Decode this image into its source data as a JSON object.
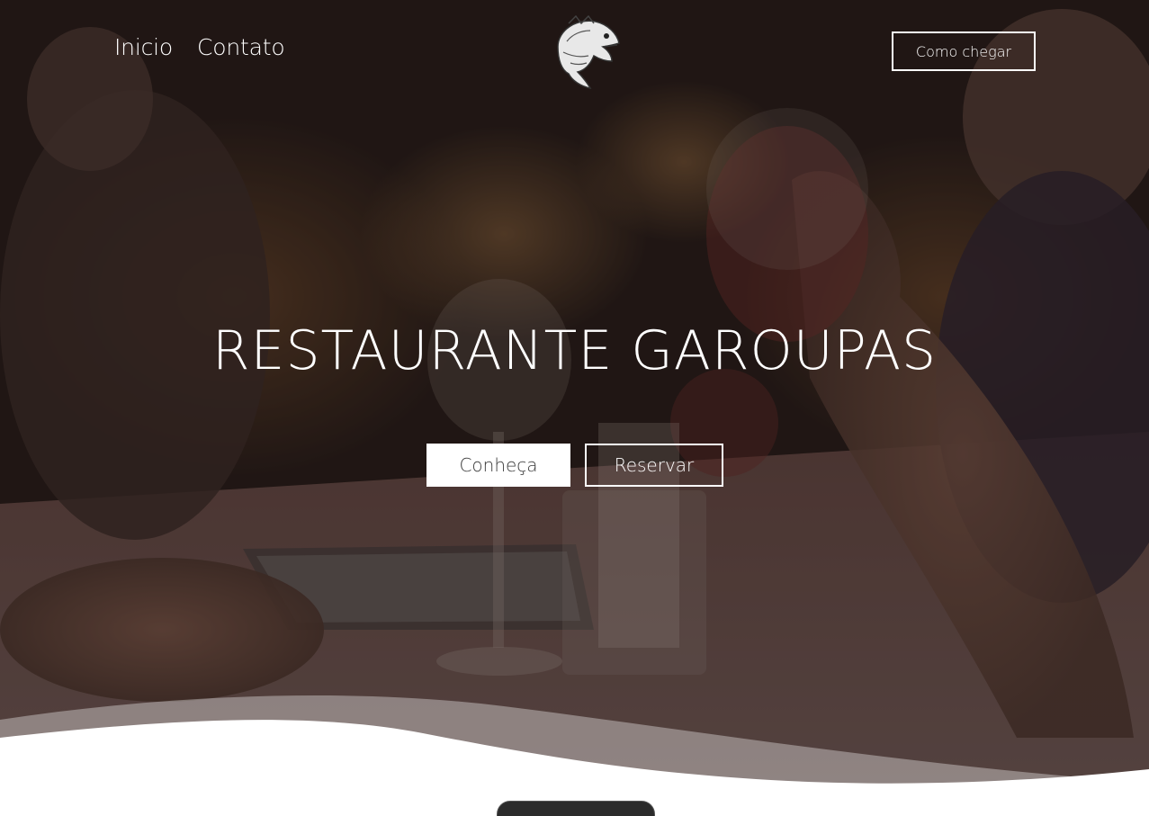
{
  "nav": {
    "items": [
      {
        "label": "Inicio"
      },
      {
        "label": "Contato"
      }
    ],
    "logo_icon": "fish-logo-icon",
    "cta_label": "Como chegar"
  },
  "hero": {
    "title": "RESTAURANTE GAROUPAS",
    "primary_button": "Conheça",
    "secondary_button": "Reservar"
  },
  "colors": {
    "overlay": "#2a1c18",
    "text": "#ffffff",
    "button_bg": "#ffffff",
    "button_text": "#3a3a3a"
  }
}
